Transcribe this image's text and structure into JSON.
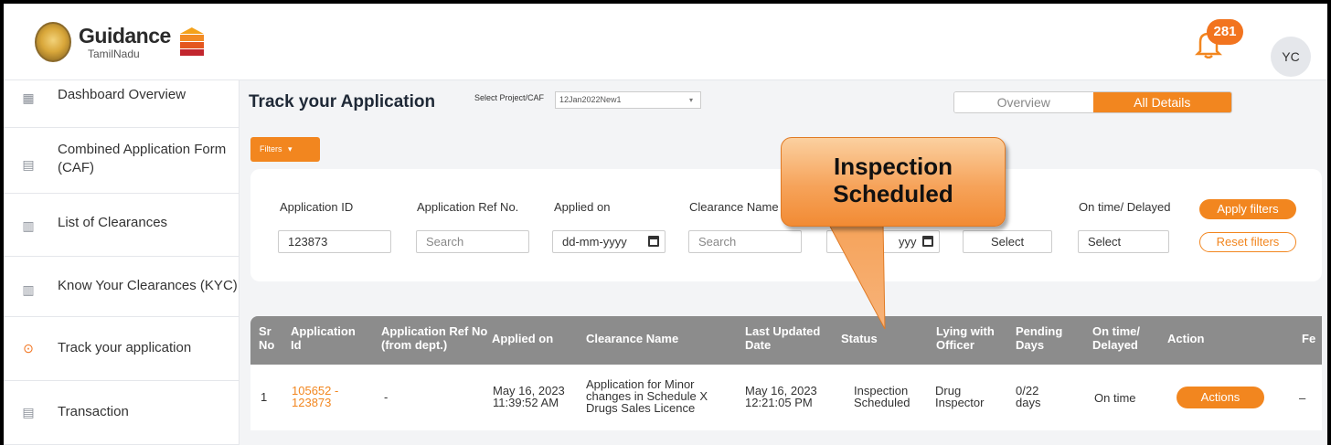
{
  "header": {
    "brand_name": "Guidance",
    "brand_sub": "TamilNadu",
    "notification_count": "281",
    "user_initials": "YC"
  },
  "sidebar": {
    "items": [
      {
        "label": "Dashboard Overview",
        "icon": "dashboard-icon"
      },
      {
        "label": "Combined Application Form (CAF)",
        "icon": "document-icon"
      },
      {
        "label": "List of Clearances",
        "icon": "list-icon"
      },
      {
        "label": "Know Your Clearances (KYC)",
        "icon": "book-icon"
      },
      {
        "label": "Track your application",
        "icon": "location-pin-icon"
      },
      {
        "label": "Transaction",
        "icon": "wallet-icon"
      }
    ]
  },
  "main": {
    "title": "Track your Application",
    "project_label": "Select Project/CAF",
    "project_value": "12Jan2022New1",
    "tabs": [
      {
        "label": "Overview"
      },
      {
        "label": "All Details"
      }
    ],
    "filters_label": "Filters"
  },
  "filters": {
    "application_id_label": "Application ID",
    "application_id_value": "123873",
    "ref_no_label": "Application Ref No.",
    "ref_no_placeholder": "Search",
    "applied_on_label": "Applied on",
    "applied_on_value": "dd-mm-yyyy",
    "clearance_label": "Clearance Name",
    "clearance_placeholder": "Search",
    "date2_value": "yyy",
    "status_value": "Select",
    "ontime_label": "On time/ Delayed",
    "ontime_value": "Select",
    "apply_label": "Apply filters",
    "reset_label": "Reset filters"
  },
  "table": {
    "headers": [
      "Sr No",
      "Application Id",
      "Application Ref No (from dept.)",
      "Applied on",
      "Clearance Name",
      "Last Updated Date",
      "Status",
      "Lying with Officer",
      "Pending Days",
      "On time/ Delayed",
      "Action",
      "Fe"
    ],
    "rows": [
      {
        "sr": "1",
        "app_id_1": "105652 -",
        "app_id_2": "123873",
        "ref_no": "-",
        "applied_1": "May 16, 2023",
        "applied_2": "11:39:52 AM",
        "clearance_1": "Application for Minor",
        "clearance_2": "changes in Schedule X",
        "clearance_3": "Drugs Sales Licence",
        "updated_1": "May 16, 2023",
        "updated_2": "12:21:05 PM",
        "status_1": "Inspection",
        "status_2": "Scheduled",
        "officer_1": "Drug",
        "officer_2": "Inspector",
        "pending_1": "0/22",
        "pending_2": "days",
        "ontime": "On time",
        "action": "Actions",
        "fee": "–"
      }
    ]
  },
  "callout": {
    "line1": "Inspection",
    "line2": "Scheduled"
  },
  "colors": {
    "accent": "#f2861f",
    "header_gray": "#8c8c8c"
  }
}
